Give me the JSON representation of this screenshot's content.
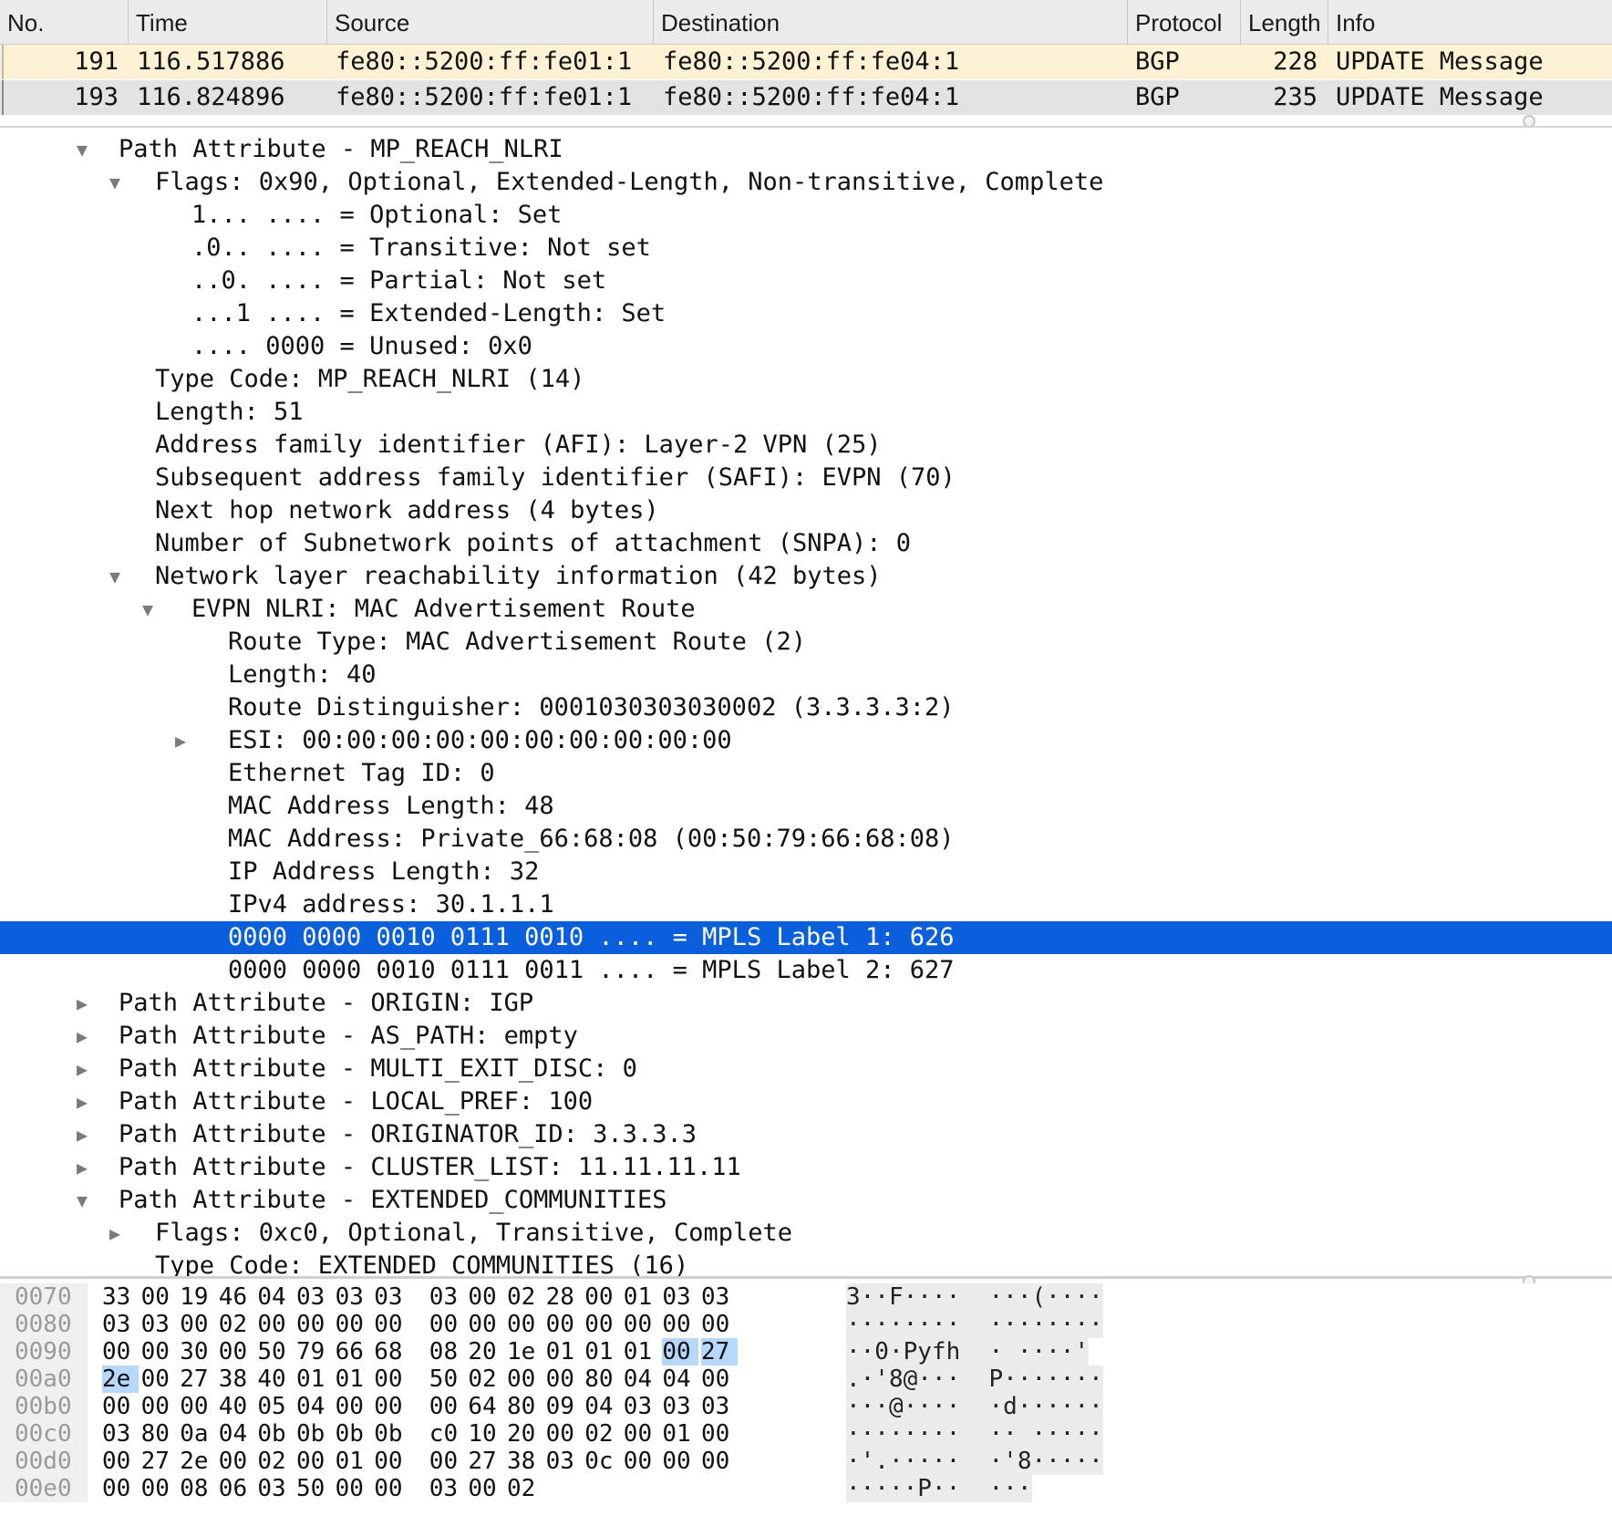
{
  "packet_list": {
    "columns": [
      "No.",
      "Time",
      "Source",
      "Destination",
      "Protocol",
      "Length",
      "Info"
    ],
    "rows": [
      {
        "no": "191",
        "time": "116.517886",
        "source": "fe80::5200:ff:fe01:1",
        "destination": "fe80::5200:ff:fe04:1",
        "protocol": "BGP",
        "length": "228",
        "info": "UPDATE Message"
      },
      {
        "no": "193",
        "time": "116.824896",
        "source": "fe80::5200:ff:fe01:1",
        "destination": "fe80::5200:ff:fe04:1",
        "protocol": "BGP",
        "length": "235",
        "info": "UPDATE Message"
      }
    ]
  },
  "tree": [
    {
      "text": "Path Attribute - MP_REACH_NLRI",
      "level": 0,
      "state": "open"
    },
    {
      "text": "Flags: 0x90, Optional, Extended-Length, Non-transitive, Complete",
      "level": 1,
      "state": "open"
    },
    {
      "text": "1... .... = Optional: Set",
      "level": 2,
      "state": "leaf"
    },
    {
      "text": ".0.. .... = Transitive: Not set",
      "level": 2,
      "state": "leaf"
    },
    {
      "text": "..0. .... = Partial: Not set",
      "level": 2,
      "state": "leaf"
    },
    {
      "text": "...1 .... = Extended-Length: Set",
      "level": 2,
      "state": "leaf"
    },
    {
      "text": ".... 0000 = Unused: 0x0",
      "level": 2,
      "state": "leaf"
    },
    {
      "text": "Type Code: MP_REACH_NLRI (14)",
      "level": 1,
      "state": "leaf"
    },
    {
      "text": "Length: 51",
      "level": 1,
      "state": "leaf"
    },
    {
      "text": "Address family identifier (AFI): Layer-2 VPN (25)",
      "level": 1,
      "state": "leaf"
    },
    {
      "text": "Subsequent address family identifier (SAFI): EVPN (70)",
      "level": 1,
      "state": "leaf"
    },
    {
      "text": "Next hop network address (4 bytes)",
      "level": 1,
      "state": "leaf"
    },
    {
      "text": "Number of Subnetwork points of attachment (SNPA): 0",
      "level": 1,
      "state": "leaf"
    },
    {
      "text": "Network layer reachability information (42 bytes)",
      "level": 1,
      "state": "open"
    },
    {
      "text": "EVPN NLRI: MAC Advertisement Route",
      "level": 2,
      "state": "open"
    },
    {
      "text": "Route Type: MAC Advertisement Route (2)",
      "level": 3,
      "state": "leaf"
    },
    {
      "text": "Length: 40",
      "level": 3,
      "state": "leaf"
    },
    {
      "text": "Route Distinguisher: 0001030303030002 (3.3.3.3:2)",
      "level": 3,
      "state": "leaf"
    },
    {
      "text": "ESI: 00:00:00:00:00:00:00:00:00:00",
      "level": 3,
      "state": "closed"
    },
    {
      "text": "Ethernet Tag ID: 0",
      "level": 3,
      "state": "leaf"
    },
    {
      "text": "MAC Address Length: 48",
      "level": 3,
      "state": "leaf"
    },
    {
      "text": "MAC Address: Private_66:68:08 (00:50:79:66:68:08)",
      "level": 3,
      "state": "leaf"
    },
    {
      "text": "IP Address Length: 32",
      "level": 3,
      "state": "leaf"
    },
    {
      "text": "IPv4 address: 30.1.1.1",
      "level": 3,
      "state": "leaf"
    },
    {
      "text": "0000 0000 0010 0111 0010 .... = MPLS Label 1: 626",
      "level": 3,
      "state": "leaf",
      "selected": true
    },
    {
      "text": "0000 0000 0010 0111 0011 .... = MPLS Label 2: 627",
      "level": 3,
      "state": "leaf"
    },
    {
      "text": "Path Attribute - ORIGIN: IGP",
      "level": 0,
      "state": "closed"
    },
    {
      "text": "Path Attribute - AS_PATH: empty",
      "level": 0,
      "state": "closed"
    },
    {
      "text": "Path Attribute - MULTI_EXIT_DISC: 0",
      "level": 0,
      "state": "closed"
    },
    {
      "text": "Path Attribute - LOCAL_PREF: 100",
      "level": 0,
      "state": "closed"
    },
    {
      "text": "Path Attribute - ORIGINATOR_ID: 3.3.3.3",
      "level": 0,
      "state": "closed"
    },
    {
      "text": "Path Attribute - CLUSTER_LIST: 11.11.11.11",
      "level": 0,
      "state": "closed"
    },
    {
      "text": "Path Attribute - EXTENDED_COMMUNITIES",
      "level": 0,
      "state": "open"
    },
    {
      "text": "Flags: 0xc0, Optional, Transitive, Complete",
      "level": 1,
      "state": "closed"
    },
    {
      "text": "Type Code: EXTENDED_COMMUNITIES (16)",
      "level": 1,
      "state": "leaf"
    }
  ],
  "hex": [
    {
      "offset": "0070",
      "bytes": [
        "33",
        "00",
        "19",
        "46",
        "04",
        "03",
        "03",
        "03",
        "03",
        "00",
        "02",
        "28",
        "00",
        "01",
        "03",
        "03"
      ],
      "hl": [],
      "ascii": "3··F····  ···(····"
    },
    {
      "offset": "0080",
      "bytes": [
        "03",
        "03",
        "00",
        "02",
        "00",
        "00",
        "00",
        "00",
        "00",
        "00",
        "00",
        "00",
        "00",
        "00",
        "00",
        "00"
      ],
      "hl": [],
      "ascii": "········  ········"
    },
    {
      "offset": "0090",
      "bytes": [
        "00",
        "00",
        "30",
        "00",
        "50",
        "79",
        "66",
        "68",
        "08",
        "20",
        "1e",
        "01",
        "01",
        "01",
        "00",
        "27"
      ],
      "hl": [
        14,
        15
      ],
      "ascii": "··0·Pyfh  · ····'"
    },
    {
      "offset": "00a0",
      "bytes": [
        "2e",
        "00",
        "27",
        "38",
        "40",
        "01",
        "01",
        "00",
        "50",
        "02",
        "00",
        "00",
        "80",
        "04",
        "04",
        "00"
      ],
      "hl": [
        0
      ],
      "ascii": ".·'8@···  P·······"
    },
    {
      "offset": "00b0",
      "bytes": [
        "00",
        "00",
        "00",
        "40",
        "05",
        "04",
        "00",
        "00",
        "00",
        "64",
        "80",
        "09",
        "04",
        "03",
        "03",
        "03"
      ],
      "hl": [],
      "ascii": "···@····  ·d······"
    },
    {
      "offset": "00c0",
      "bytes": [
        "03",
        "80",
        "0a",
        "04",
        "0b",
        "0b",
        "0b",
        "0b",
        "c0",
        "10",
        "20",
        "00",
        "02",
        "00",
        "01",
        "00"
      ],
      "hl": [],
      "ascii": "········  ·· ·····"
    },
    {
      "offset": "00d0",
      "bytes": [
        "00",
        "27",
        "2e",
        "00",
        "02",
        "00",
        "01",
        "00",
        "00",
        "27",
        "38",
        "03",
        "0c",
        "00",
        "00",
        "00"
      ],
      "hl": [],
      "ascii": "·'.·····  ·'8·····"
    },
    {
      "offset": "00e0",
      "bytes": [
        "00",
        "00",
        "08",
        "06",
        "03",
        "50",
        "00",
        "00",
        "03",
        "00",
        "02"
      ],
      "hl": [],
      "ascii": "·····P··  ···"
    }
  ]
}
